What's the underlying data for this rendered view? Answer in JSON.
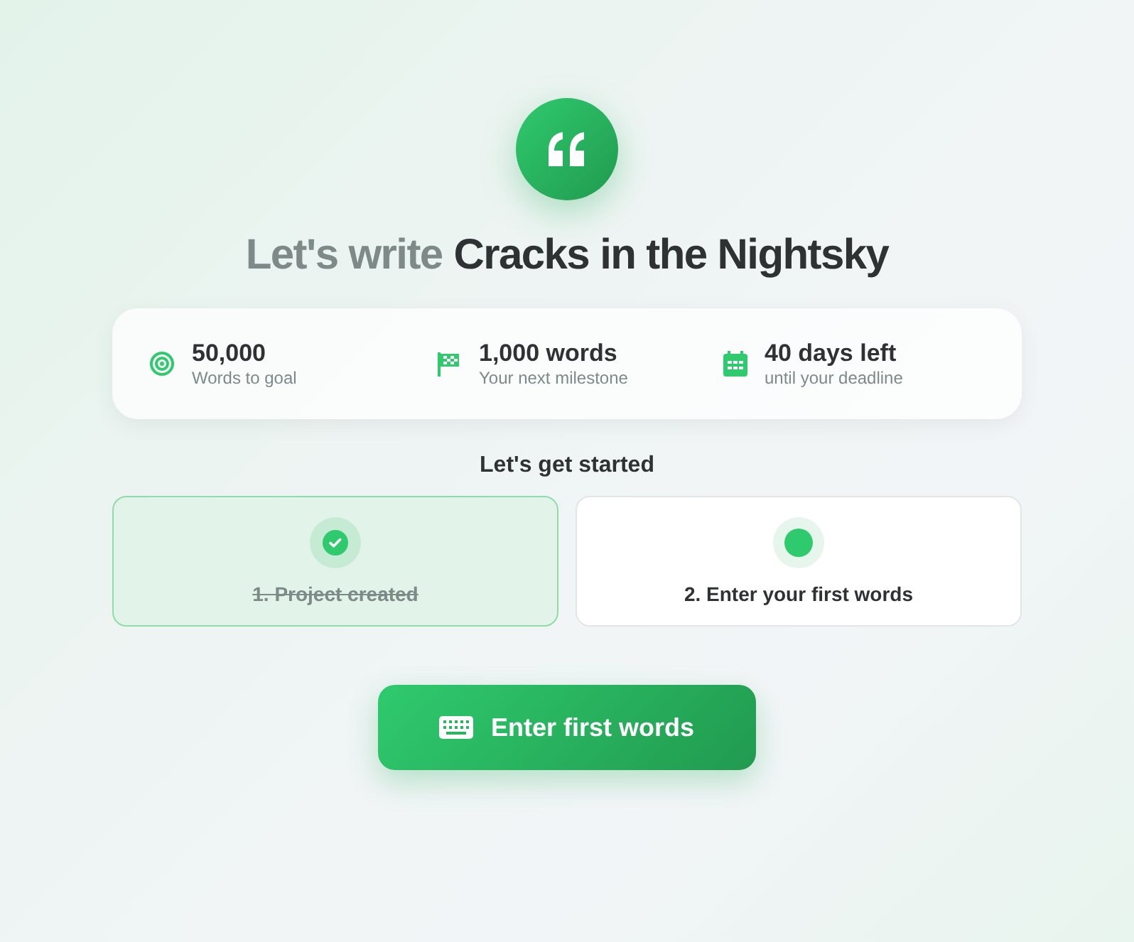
{
  "heading": {
    "prefix": "Let's write",
    "project": "Cracks in the Nightsky"
  },
  "stats": [
    {
      "kind": "target",
      "value": "50,000",
      "label": "Words to goal"
    },
    {
      "kind": "flag",
      "value": "1,000 words",
      "label": "Your next milestone"
    },
    {
      "kind": "calendar",
      "value": "40 days left",
      "label": "until your deadline"
    }
  ],
  "steps_title": "Let's get started",
  "steps": [
    {
      "label": "1. Project created",
      "completed": true
    },
    {
      "label": "2. Enter your first words",
      "completed": false
    }
  ],
  "action_button": {
    "label": "Enter first words"
  }
}
